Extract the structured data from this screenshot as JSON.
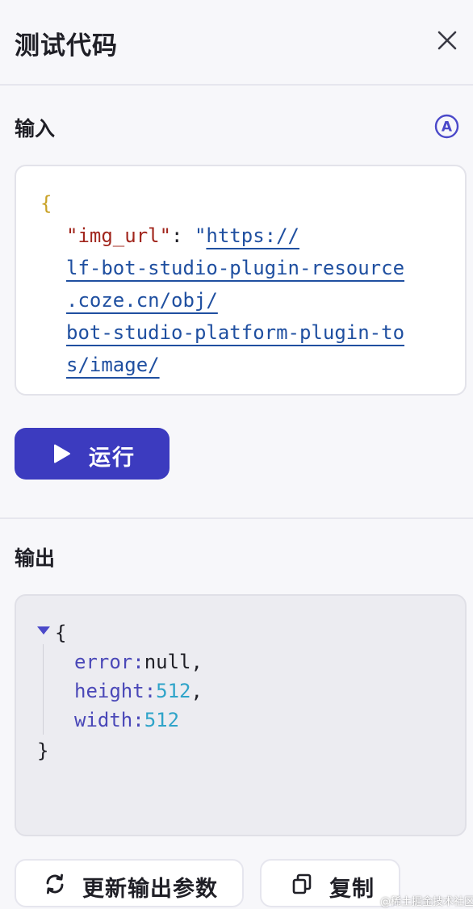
{
  "header": {
    "title": "测试代码",
    "close_icon": "close-icon"
  },
  "input": {
    "label": "输入",
    "auto_icon": "circled-a-icon",
    "auto_letter": "A",
    "code": {
      "brace_open": "{",
      "key": "\"img_url\"",
      "colon": ":",
      "quote": "\"",
      "url_lines": [
        "https://",
        "lf-bot-studio-plugin-resource",
        ".coze.cn/obj/",
        "bot-studio-platform-plugin-to",
        "s/image/"
      ]
    }
  },
  "run_button": {
    "label": "运行",
    "icon": "play-icon"
  },
  "output": {
    "label": "输出",
    "toggle_icon": "collapse-triangle-icon",
    "brace_open": "{",
    "brace_close": "}",
    "fields": [
      {
        "key": "error",
        "value": "null",
        "suffix": ","
      },
      {
        "key": "height",
        "value": "512",
        "suffix": ","
      },
      {
        "key": "width",
        "value": "512",
        "suffix": ""
      }
    ]
  },
  "actions": {
    "update_label": "更新输出参数",
    "update_icon": "refresh-icon",
    "copy_label": "复制",
    "copy_icon": "copy-icon"
  },
  "watermark": "@稀土掘金技术社区",
  "colors": {
    "accent": "#3c3bbf",
    "json_key": "#a1261d",
    "link": "#1f4fa0",
    "output_key": "#4a48b8",
    "output_number": "#2fa4c9",
    "brace": "#c9a227"
  }
}
